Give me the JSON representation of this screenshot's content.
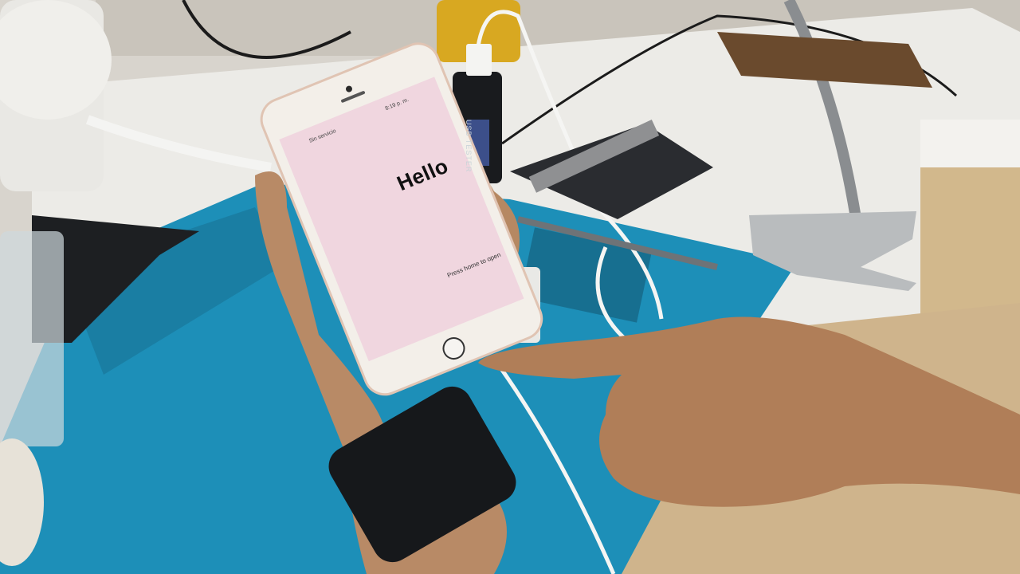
{
  "phone_screen": {
    "carrier": "Sin servicio",
    "time": "8:19 p. m.",
    "greeting": "Hello",
    "prompt": "Press home to open"
  },
  "usb_tester": {
    "label": "USB TESTER"
  },
  "colors": {
    "mat_blue": "#1d8fb8",
    "phone_screen_pink": "#f0d6df",
    "phone_body": "#f3efe9",
    "desk_white": "#eeebe5",
    "skin": "#b98b68"
  }
}
